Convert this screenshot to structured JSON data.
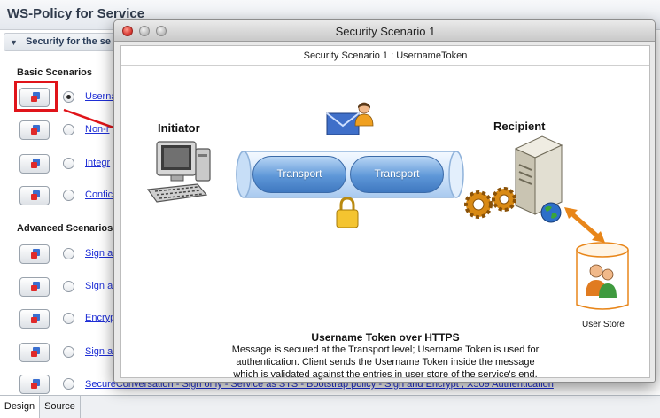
{
  "editor": {
    "title": "WS-Policy for Service",
    "section_label": "Security for the se",
    "basic_label": "Basic Scenarios",
    "advanced_label": "Advanced Scenarios",
    "basic_rows": [
      {
        "link": "Userna",
        "selected": true
      },
      {
        "link": "Non-r",
        "selected": false
      },
      {
        "link": "Integr",
        "selected": false
      },
      {
        "link": "Confic",
        "selected": false
      }
    ],
    "advanced_rows": [
      {
        "link": "Sign a",
        "selected": false
      },
      {
        "link": "Sign a",
        "selected": false
      },
      {
        "link": "Encryp",
        "selected": false
      },
      {
        "link": "Sign a",
        "selected": false
      }
    ],
    "bottom_link": "SecureConversation - Sign only - Service as STS - Bootstrap policy - Sign and Encrypt , X509 Authentication",
    "tabs": [
      "Design",
      "Source"
    ]
  },
  "dialog": {
    "title": "Security Scenario 1",
    "subtitle": "Security Scenario 1 : UsernameToken",
    "initiator": "Initiator",
    "recipient": "Recipient",
    "transport_left": "Transport",
    "transport_right": "Transport",
    "user_store": "User Store",
    "desc_title": "Username Token over HTTPS",
    "desc_lines": [
      "Message is secured at the Transport level; Username Token is used for",
      "authentication.  Client sends the Username Token inside the message",
      "which is validated against the entries in user store of the service's end."
    ]
  },
  "colors": {
    "highlight": "#e0141a",
    "link": "#1e2ed6",
    "transport": "#5e97d8"
  },
  "icons": [
    "policy-button-icon",
    "envelope-icon",
    "user-icon",
    "computer-icon",
    "lock-icon",
    "server-icon",
    "gear-icon",
    "globe-icon",
    "user-store-icon",
    "arrow-icon",
    "close-button-icon"
  ]
}
